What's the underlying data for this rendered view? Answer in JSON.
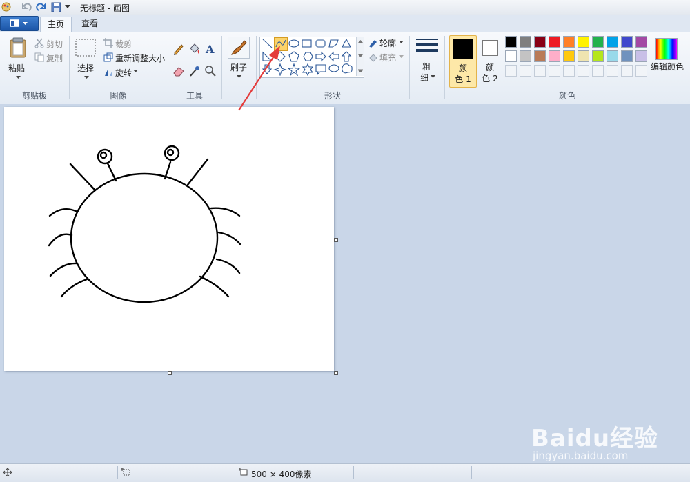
{
  "window": {
    "title": "无标题 - 画图"
  },
  "tabs": [
    {
      "label": "主页"
    },
    {
      "label": "查看"
    }
  ],
  "clipboard": {
    "paste": "粘贴",
    "cut": "剪切",
    "copy": "复制",
    "group": "剪贴板"
  },
  "image": {
    "select": "选择",
    "crop": "裁剪",
    "resize": "重新调整大小",
    "rotate": "旋转",
    "group": "图像"
  },
  "tools": {
    "group": "工具"
  },
  "brushes": {
    "label": "刷子"
  },
  "shapes": {
    "outline": "轮廓",
    "fill": "填充",
    "group": "形状"
  },
  "size": {
    "label_top": "粗",
    "label_bottom": "细"
  },
  "colors": {
    "color1_top": "颜",
    "color1_bottom": "色 1",
    "color2_top": "颜",
    "color2_bottom": "色 2",
    "edit": "编辑颜色",
    "group": "颜色",
    "palette_row1": [
      "#000000",
      "#7f7f7f",
      "#880015",
      "#ed1c24",
      "#ff7f27",
      "#fff200",
      "#22b14c",
      "#00a2e8",
      "#3f48cc",
      "#a349a4"
    ],
    "palette_row2": [
      "#ffffff",
      "#c3c3c3",
      "#b97a57",
      "#ffaec9",
      "#ffc90e",
      "#efe4b0",
      "#b5e61d",
      "#99d9ea",
      "#7092be",
      "#c8bfe7"
    ]
  },
  "status": {
    "canvas_size": "500 × 400像素"
  },
  "watermark": {
    "brand": "Baidu经验",
    "url": "jingyan.baidu.com"
  }
}
